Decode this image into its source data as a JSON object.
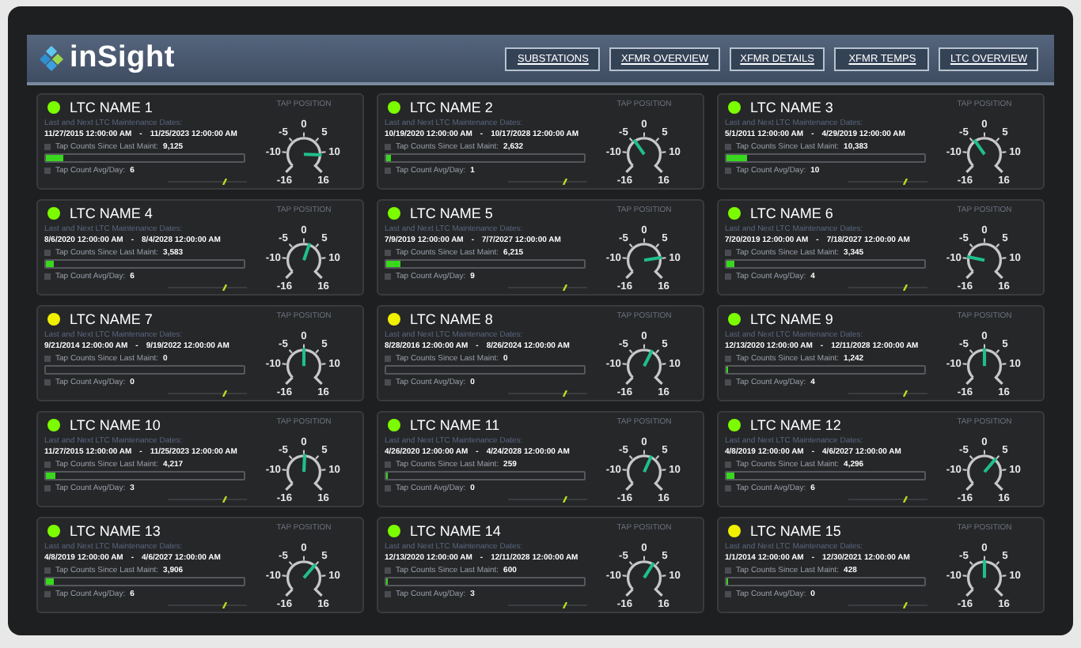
{
  "header": {
    "logo_text": "inSight",
    "nav": [
      {
        "label": "SUBSTATIONS"
      },
      {
        "label": "XFMR OVERVIEW"
      },
      {
        "label": "XFMR DETAILS"
      },
      {
        "label": "XFMR TEMPS"
      },
      {
        "label": "LTC OVERVIEW"
      }
    ]
  },
  "cards": [
    {
      "name": "LTC NAME 1",
      "color": "#7cfc00",
      "dates_label": "Last and Next LTC Maintenance Dates:",
      "start": "11/27/2015 12:00:00 AM",
      "sep": "-",
      "end": "11/25/2023 12:00:00 AM",
      "counts_label": "Tap Counts Since Last Maint:",
      "counts": "9,125",
      "level": 0.09,
      "avg_label": "Tap Count Avg/Day:",
      "avg": "6",
      "gauge_title": "TAP POSITION",
      "dial": [
        "-16",
        "-10",
        "-5",
        "0",
        "5",
        "10",
        "16"
      ]
    },
    {
      "name": "LTC NAME 2",
      "color": "#7cfc00",
      "dates_label": "Last and Next LTC Maintenance Dates:",
      "start": "10/19/2020 12:00:00 AM",
      "sep": "-",
      "end": "10/17/2028 12:00:00 AM",
      "counts_label": "Tap Counts Since Last Maint:",
      "counts": "2,632",
      "level": 0.02,
      "avg_label": "Tap Count Avg/Day:",
      "avg": "1",
      "gauge_title": "TAP POSITION",
      "dial": [
        "-16",
        "-10",
        "-5",
        "0",
        "5",
        "10",
        "16"
      ]
    },
    {
      "name": "LTC NAME 3",
      "color": "#7cfc00",
      "dates_label": "Last and Next LTC Maintenance Dates:",
      "start": "5/1/2011 12:00:00 AM",
      "sep": "-",
      "end": "4/29/2019 12:00:00 AM",
      "counts_label": "Tap Counts Since Last Maint:",
      "counts": "10,383",
      "level": 0.1,
      "avg_label": "Tap Count Avg/Day:",
      "avg": "10",
      "gauge_title": "TAP POSITION",
      "dial": [
        "-16",
        "-10",
        "-5",
        "0",
        "5",
        "10",
        "16"
      ]
    },
    {
      "name": "LTC NAME 4",
      "color": "#7cfc00",
      "dates_label": "Last and Next LTC Maintenance Dates:",
      "start": "8/6/2020 12:00:00 AM",
      "sep": "-",
      "end": "8/4/2028 12:00:00 AM",
      "counts_label": "Tap Counts Since Last Maint:",
      "counts": "3,583",
      "level": 0.04,
      "avg_label": "Tap Count Avg/Day:",
      "avg": "6",
      "gauge_title": "TAP POSITION",
      "dial": [
        "-16",
        "-10",
        "-5",
        "0",
        "5",
        "10",
        "16"
      ]
    },
    {
      "name": "LTC NAME 5",
      "color": "#7cfc00",
      "dates_label": "Last and Next LTC Maintenance Dates:",
      "start": "7/9/2019 12:00:00 AM",
      "sep": "-",
      "end": "7/7/2027 12:00:00 AM",
      "counts_label": "Tap Counts Since Last Maint:",
      "counts": "6,215",
      "level": 0.07,
      "avg_label": "Tap Count Avg/Day:",
      "avg": "9",
      "gauge_title": "TAP POSITION",
      "dial": [
        "-16",
        "-10",
        "-5",
        "0",
        "5",
        "10",
        "16"
      ]
    },
    {
      "name": "LTC NAME 6",
      "color": "#7cfc00",
      "dates_label": "Last and Next LTC Maintenance Dates:",
      "start": "7/20/2019 12:00:00 AM",
      "sep": "-",
      "end": "7/18/2027 12:00:00 AM",
      "counts_label": "Tap Counts Since Last Maint:",
      "counts": "3,345",
      "level": 0.04,
      "avg_label": "Tap Count Avg/Day:",
      "avg": "4",
      "gauge_title": "TAP POSITION",
      "dial": [
        "-16",
        "-10",
        "-5",
        "0",
        "5",
        "10",
        "16"
      ]
    },
    {
      "name": "LTC NAME 7",
      "color": "#f0f000",
      "dates_label": "Last and Next LTC Maintenance Dates:",
      "start": "9/21/2014 12:00:00 AM",
      "sep": "-",
      "end": "9/19/2022 12:00:00 AM",
      "counts_label": "Tap Counts Since Last Maint:",
      "counts": "0",
      "level": 0,
      "avg_label": "Tap Count Avg/Day:",
      "avg": "0",
      "gauge_title": "TAP POSITION",
      "dial": [
        "-16",
        "-10",
        "-5",
        "0",
        "5",
        "10",
        "16"
      ]
    },
    {
      "name": "LTC NAME 8",
      "color": "#f0f000",
      "dates_label": "Last and Next LTC Maintenance Dates:",
      "start": "8/28/2016 12:00:00 AM",
      "sep": "-",
      "end": "8/26/2024 12:00:00 AM",
      "counts_label": "Tap Counts Since Last Maint:",
      "counts": "0",
      "level": 0,
      "avg_label": "Tap Count Avg/Day:",
      "avg": "0",
      "gauge_title": "TAP POSITION",
      "dial": [
        "-16",
        "-10",
        "-5",
        "0",
        "5",
        "10",
        "16"
      ]
    },
    {
      "name": "LTC NAME 9",
      "color": "#7cfc00",
      "dates_label": "Last and Next LTC Maintenance Dates:",
      "start": "12/13/2020 12:00:00 AM",
      "sep": "-",
      "end": "12/11/2028 12:00:00 AM",
      "counts_label": "Tap Counts Since Last Maint:",
      "counts": "1,242",
      "level": 0.01,
      "avg_label": "Tap Count Avg/Day:",
      "avg": "4",
      "gauge_title": "TAP POSITION",
      "dial": [
        "-16",
        "-10",
        "-5",
        "0",
        "5",
        "10",
        "16"
      ]
    },
    {
      "name": "LTC NAME 10",
      "color": "#7cfc00",
      "dates_label": "Last and Next LTC Maintenance Dates:",
      "start": "11/27/2015 12:00:00 AM",
      "sep": "-",
      "end": "11/25/2023 12:00:00 AM",
      "counts_label": "Tap Counts Since Last Maint:",
      "counts": "4,217",
      "level": 0.05,
      "avg_label": "Tap Count Avg/Day:",
      "avg": "3",
      "gauge_title": "TAP POSITION",
      "dial": [
        "-16",
        "-10",
        "-5",
        "0",
        "5",
        "10",
        "16"
      ]
    },
    {
      "name": "LTC NAME 11",
      "color": "#7cfc00",
      "dates_label": "Last and Next LTC Maintenance Dates:",
      "start": "4/26/2020 12:00:00 AM",
      "sep": "-",
      "end": "4/24/2028 12:00:00 AM",
      "counts_label": "Tap Counts Since Last Maint:",
      "counts": "259",
      "level": 0.005,
      "avg_label": "Tap Count Avg/Day:",
      "avg": "0",
      "gauge_title": "TAP POSITION",
      "dial": [
        "-16",
        "-10",
        "-5",
        "0",
        "5",
        "10",
        "16"
      ]
    },
    {
      "name": "LTC NAME 12",
      "color": "#7cfc00",
      "dates_label": "Last and Next LTC Maintenance Dates:",
      "start": "4/8/2019 12:00:00 AM",
      "sep": "-",
      "end": "4/6/2027 12:00:00 AM",
      "counts_label": "Tap Counts Since Last Maint:",
      "counts": "4,296",
      "level": 0.04,
      "avg_label": "Tap Count Avg/Day:",
      "avg": "6",
      "gauge_title": "TAP POSITION",
      "dial": [
        "-16",
        "-10",
        "-5",
        "0",
        "5",
        "10",
        "16"
      ]
    },
    {
      "name": "LTC NAME 13",
      "color": "#7cfc00",
      "dates_label": "Last and Next LTC Maintenance Dates:",
      "start": "4/8/2019 12:00:00 AM",
      "sep": "-",
      "end": "4/6/2027 12:00:00 AM",
      "counts_label": "Tap Counts Since Last Maint:",
      "counts": "3,906",
      "level": 0.04,
      "avg_label": "Tap Count Avg/Day:",
      "avg": "6",
      "gauge_title": "TAP POSITION",
      "dial": [
        "-16",
        "-10",
        "-5",
        "0",
        "5",
        "10",
        "16"
      ]
    },
    {
      "name": "LTC NAME 14",
      "color": "#7cfc00",
      "dates_label": "Last and Next LTC Maintenance Dates:",
      "start": "12/13/2020 12:00:00 AM",
      "sep": "-",
      "end": "12/11/2028 12:00:00 AM",
      "counts_label": "Tap Counts Since Last Maint:",
      "counts": "600",
      "level": 0.01,
      "avg_label": "Tap Count Avg/Day:",
      "avg": "3",
      "gauge_title": "TAP POSITION",
      "dial": [
        "-16",
        "-10",
        "-5",
        "0",
        "5",
        "10",
        "16"
      ]
    },
    {
      "name": "LTC NAME 15",
      "color": "#f0f000",
      "dates_label": "Last and Next LTC Maintenance Dates:",
      "start": "1/1/2014 12:00:00 AM",
      "sep": "-",
      "end": "12/30/2021 12:00:00 AM",
      "counts_label": "Tap Counts Since Last Maint:",
      "counts": "428",
      "level": 0.005,
      "avg_label": "Tap Count Avg/Day:",
      "avg": "0",
      "gauge_title": "TAP POSITION",
      "dial": [
        "-16",
        "-10",
        "-5",
        "0",
        "5",
        "10",
        "16"
      ]
    }
  ]
}
